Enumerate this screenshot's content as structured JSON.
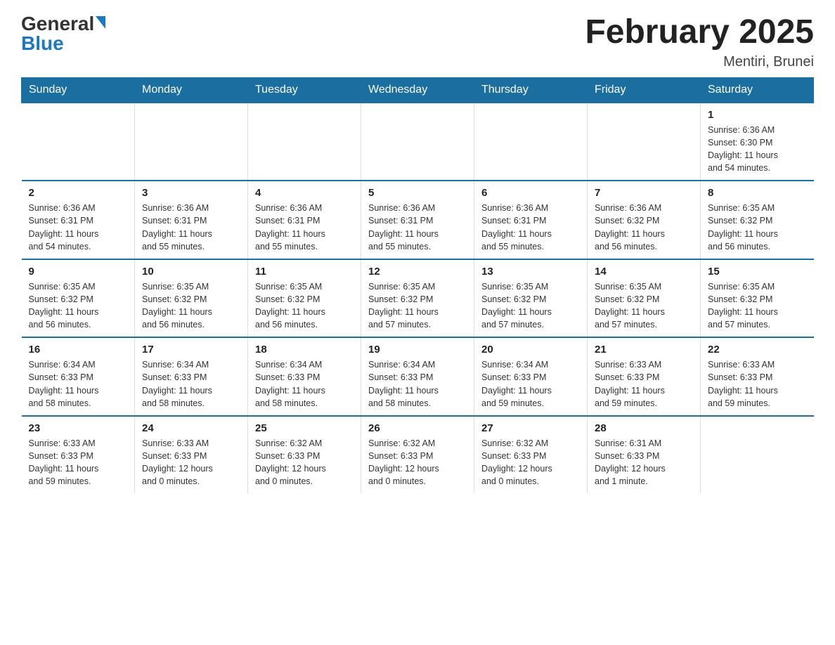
{
  "header": {
    "logo_general": "General",
    "logo_blue": "Blue",
    "title": "February 2025",
    "subtitle": "Mentiri, Brunei"
  },
  "days_of_week": [
    "Sunday",
    "Monday",
    "Tuesday",
    "Wednesday",
    "Thursday",
    "Friday",
    "Saturday"
  ],
  "weeks": [
    [
      {
        "day": "",
        "info": ""
      },
      {
        "day": "",
        "info": ""
      },
      {
        "day": "",
        "info": ""
      },
      {
        "day": "",
        "info": ""
      },
      {
        "day": "",
        "info": ""
      },
      {
        "day": "",
        "info": ""
      },
      {
        "day": "1",
        "info": "Sunrise: 6:36 AM\nSunset: 6:30 PM\nDaylight: 11 hours\nand 54 minutes."
      }
    ],
    [
      {
        "day": "2",
        "info": "Sunrise: 6:36 AM\nSunset: 6:31 PM\nDaylight: 11 hours\nand 54 minutes."
      },
      {
        "day": "3",
        "info": "Sunrise: 6:36 AM\nSunset: 6:31 PM\nDaylight: 11 hours\nand 55 minutes."
      },
      {
        "day": "4",
        "info": "Sunrise: 6:36 AM\nSunset: 6:31 PM\nDaylight: 11 hours\nand 55 minutes."
      },
      {
        "day": "5",
        "info": "Sunrise: 6:36 AM\nSunset: 6:31 PM\nDaylight: 11 hours\nand 55 minutes."
      },
      {
        "day": "6",
        "info": "Sunrise: 6:36 AM\nSunset: 6:31 PM\nDaylight: 11 hours\nand 55 minutes."
      },
      {
        "day": "7",
        "info": "Sunrise: 6:36 AM\nSunset: 6:32 PM\nDaylight: 11 hours\nand 56 minutes."
      },
      {
        "day": "8",
        "info": "Sunrise: 6:35 AM\nSunset: 6:32 PM\nDaylight: 11 hours\nand 56 minutes."
      }
    ],
    [
      {
        "day": "9",
        "info": "Sunrise: 6:35 AM\nSunset: 6:32 PM\nDaylight: 11 hours\nand 56 minutes."
      },
      {
        "day": "10",
        "info": "Sunrise: 6:35 AM\nSunset: 6:32 PM\nDaylight: 11 hours\nand 56 minutes."
      },
      {
        "day": "11",
        "info": "Sunrise: 6:35 AM\nSunset: 6:32 PM\nDaylight: 11 hours\nand 56 minutes."
      },
      {
        "day": "12",
        "info": "Sunrise: 6:35 AM\nSunset: 6:32 PM\nDaylight: 11 hours\nand 57 minutes."
      },
      {
        "day": "13",
        "info": "Sunrise: 6:35 AM\nSunset: 6:32 PM\nDaylight: 11 hours\nand 57 minutes."
      },
      {
        "day": "14",
        "info": "Sunrise: 6:35 AM\nSunset: 6:32 PM\nDaylight: 11 hours\nand 57 minutes."
      },
      {
        "day": "15",
        "info": "Sunrise: 6:35 AM\nSunset: 6:32 PM\nDaylight: 11 hours\nand 57 minutes."
      }
    ],
    [
      {
        "day": "16",
        "info": "Sunrise: 6:34 AM\nSunset: 6:33 PM\nDaylight: 11 hours\nand 58 minutes."
      },
      {
        "day": "17",
        "info": "Sunrise: 6:34 AM\nSunset: 6:33 PM\nDaylight: 11 hours\nand 58 minutes."
      },
      {
        "day": "18",
        "info": "Sunrise: 6:34 AM\nSunset: 6:33 PM\nDaylight: 11 hours\nand 58 minutes."
      },
      {
        "day": "19",
        "info": "Sunrise: 6:34 AM\nSunset: 6:33 PM\nDaylight: 11 hours\nand 58 minutes."
      },
      {
        "day": "20",
        "info": "Sunrise: 6:34 AM\nSunset: 6:33 PM\nDaylight: 11 hours\nand 59 minutes."
      },
      {
        "day": "21",
        "info": "Sunrise: 6:33 AM\nSunset: 6:33 PM\nDaylight: 11 hours\nand 59 minutes."
      },
      {
        "day": "22",
        "info": "Sunrise: 6:33 AM\nSunset: 6:33 PM\nDaylight: 11 hours\nand 59 minutes."
      }
    ],
    [
      {
        "day": "23",
        "info": "Sunrise: 6:33 AM\nSunset: 6:33 PM\nDaylight: 11 hours\nand 59 minutes."
      },
      {
        "day": "24",
        "info": "Sunrise: 6:33 AM\nSunset: 6:33 PM\nDaylight: 12 hours\nand 0 minutes."
      },
      {
        "day": "25",
        "info": "Sunrise: 6:32 AM\nSunset: 6:33 PM\nDaylight: 12 hours\nand 0 minutes."
      },
      {
        "day": "26",
        "info": "Sunrise: 6:32 AM\nSunset: 6:33 PM\nDaylight: 12 hours\nand 0 minutes."
      },
      {
        "day": "27",
        "info": "Sunrise: 6:32 AM\nSunset: 6:33 PM\nDaylight: 12 hours\nand 0 minutes."
      },
      {
        "day": "28",
        "info": "Sunrise: 6:31 AM\nSunset: 6:33 PM\nDaylight: 12 hours\nand 1 minute."
      },
      {
        "day": "",
        "info": ""
      }
    ]
  ]
}
